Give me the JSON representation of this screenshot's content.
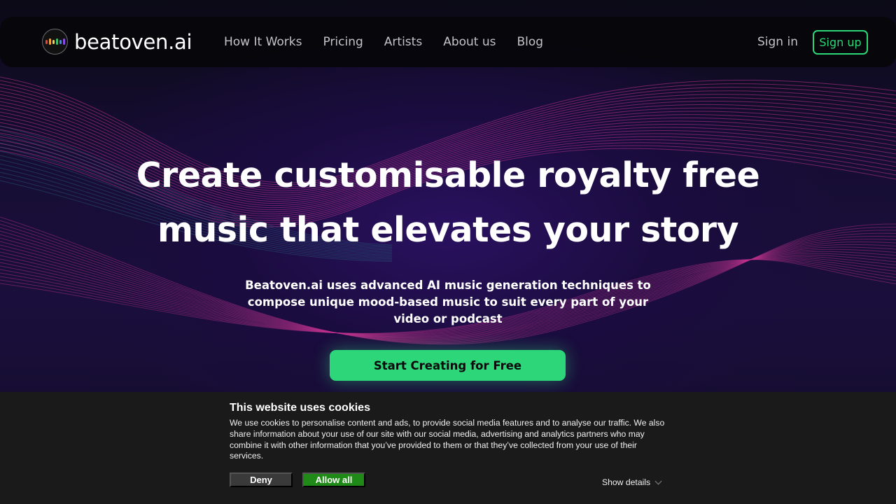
{
  "nav": {
    "logo_text": "beatoven.ai",
    "links": [
      "How It Works",
      "Pricing",
      "Artists",
      "About us",
      "Blog"
    ],
    "signin_label": "Sign in",
    "signup_label": "Sign up"
  },
  "hero": {
    "title_line1": "Create customisable royalty free",
    "title_line2": "music that elevates your story",
    "subtitle": "Beatoven.ai uses advanced AI music generation techniques to compose unique mood-based music to suit every part of your video or podcast",
    "cta_label": "Start Creating for Free"
  },
  "cookie": {
    "title": "This website uses cookies",
    "text": "We use cookies to personalise content and ads, to provide social media features and to analyse our traffic. We also share information about your use of our site with our social media, advertising and analytics partners who may combine it with other information that you’ve provided to them or that they’ve collected from your use of their services.",
    "deny_label": "Deny",
    "allow_label": "Allow all",
    "details_label": "Show details"
  },
  "colors": {
    "accent_green": "#2ed67a",
    "wave_pink": "#c2348f",
    "wave_teal": "#2a5a7a",
    "allow_green": "#1f8a18"
  }
}
